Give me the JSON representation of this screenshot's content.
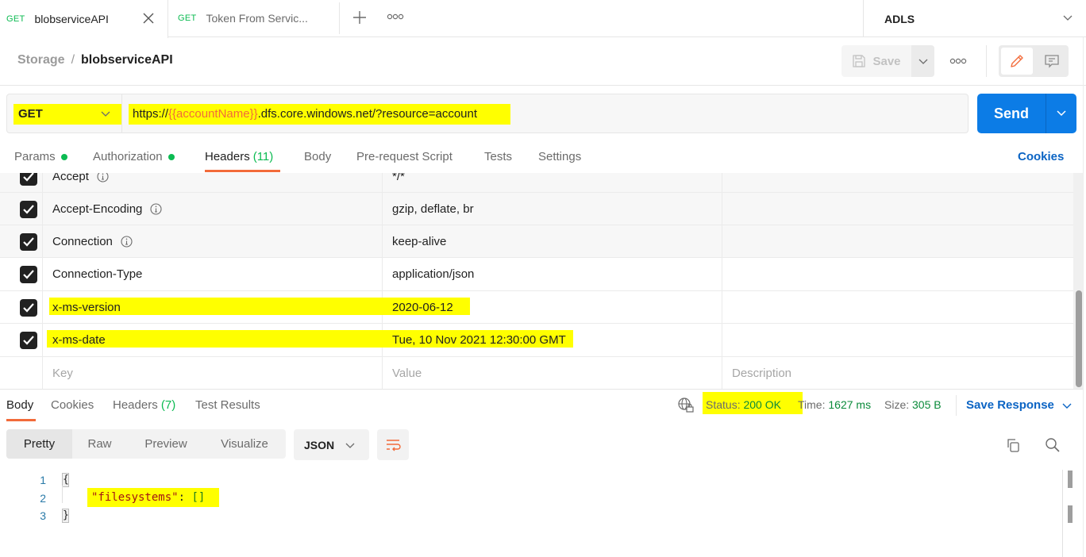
{
  "tabs": [
    {
      "method": "GET",
      "name": "blobserviceAPI",
      "active": true
    },
    {
      "method": "GET",
      "name": "Token From Servic...",
      "active": false
    }
  ],
  "environment": {
    "name": "ADLS"
  },
  "breadcrumb": {
    "parent": "Storage",
    "separator": "/",
    "current": "blobserviceAPI"
  },
  "toolbar": {
    "save_label": "Save"
  },
  "request": {
    "method": "GET",
    "url_prefix": "https://",
    "url_variable": "{{accountName}}",
    "url_suffix": ".dfs.core.windows.net/?resource=account",
    "send_label": "Send"
  },
  "request_tabs": [
    {
      "label": "Params",
      "dot": true
    },
    {
      "label": "Authorization",
      "dot": true
    },
    {
      "label": "Headers",
      "count": "(11)",
      "active": true
    },
    {
      "label": "Body"
    },
    {
      "label": "Pre-request Script"
    },
    {
      "label": "Tests"
    },
    {
      "label": "Settings"
    }
  ],
  "cookies_link": "Cookies",
  "headers": {
    "rows": [
      {
        "key": "Accept",
        "value": "*/*",
        "checked": true,
        "info": true,
        "auto": true
      },
      {
        "key": "Accept-Encoding",
        "value": "gzip, deflate, br",
        "checked": true,
        "info": true,
        "auto": true
      },
      {
        "key": "Connection",
        "value": "keep-alive",
        "checked": true,
        "info": true,
        "auto": true
      },
      {
        "key": "Connection-Type",
        "value": "application/json",
        "checked": true
      },
      {
        "key": "x-ms-version",
        "value": "2020-06-12",
        "checked": true,
        "highlighted": true
      },
      {
        "key": "x-ms-date",
        "value": "Tue, 10 Nov 2021 12:30:00 GMT",
        "checked": true,
        "highlighted": true
      }
    ],
    "placeholders": {
      "key": "Key",
      "value": "Value",
      "description": "Description"
    }
  },
  "response": {
    "tabs": [
      {
        "label": "Body",
        "active": true
      },
      {
        "label": "Cookies"
      },
      {
        "label": "Headers",
        "count": "(7)"
      },
      {
        "label": "Test Results"
      }
    ],
    "status_label": "Status:",
    "status_value": "200 OK",
    "time_label": "Time:",
    "time_value": "1627 ms",
    "size_label": "Size:",
    "size_value": "305 B",
    "save_response_label": "Save Response",
    "formats": [
      "Pretty",
      "Raw",
      "Preview",
      "Visualize"
    ],
    "active_format": "Pretty",
    "language": "JSON",
    "body_lines": [
      {
        "n": "1",
        "text": "{"
      },
      {
        "n": "2",
        "key": "\"filesystems\"",
        "colon": ": ",
        "value": "[]"
      },
      {
        "n": "3",
        "text": "}"
      }
    ]
  },
  "colors": {
    "accent_orange": "#f26b3a",
    "send_blue": "#0c7ce6",
    "link_blue": "#0b64c4",
    "method_green": "#0cbb52",
    "highlight_yellow": "#ffff00"
  }
}
